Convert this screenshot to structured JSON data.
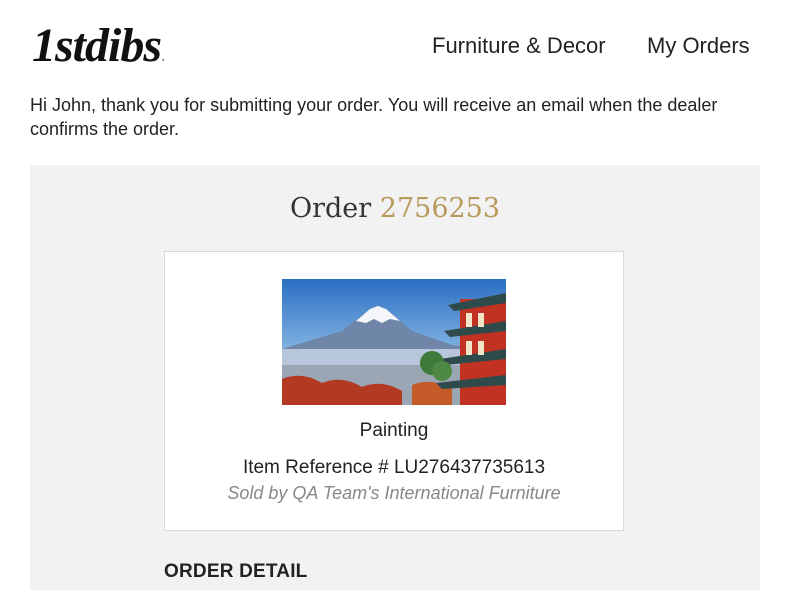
{
  "header": {
    "logo_text": "1stdibs",
    "logo_dot": ".",
    "nav": [
      {
        "label": "Furniture & Decor"
      },
      {
        "label": "My Orders"
      }
    ]
  },
  "message": "Hi John, thank you for submitting your order. You will receive an email when the dealer confirms the order.",
  "order": {
    "label": "Order",
    "number": "2756253"
  },
  "item": {
    "image": "painting-thumbnail",
    "name": "Painting",
    "reference": "Item Reference # LU276437735613",
    "seller": "Sold by QA Team's International Furniture"
  },
  "order_detail_heading": "ORDER DETAIL",
  "colors": {
    "accent": "#b89a5c",
    "panel_bg": "#f2f2f2"
  }
}
